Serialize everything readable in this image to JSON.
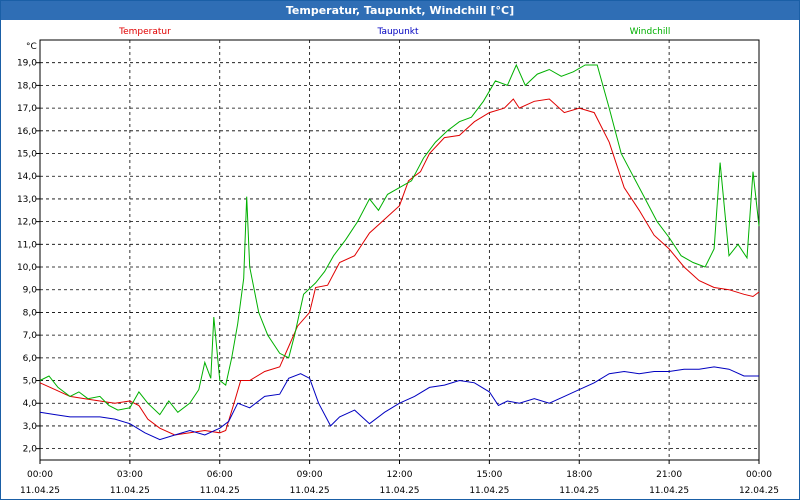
{
  "window": {
    "title": "Temperatur, Taupunkt, Windchill [°C]"
  },
  "chart_data": {
    "type": "line",
    "title": "Temperatur, Taupunkt, Windchill [°C]",
    "ylabel": "°C",
    "xlabel": "",
    "ylim": [
      1.5,
      20
    ],
    "xlim": [
      0,
      24
    ],
    "grid": true,
    "legend_placement": "top",
    "y_ticks": [
      "2,0",
      "3,0",
      "4,0",
      "5,0",
      "6,0",
      "7,0",
      "8,0",
      "9,0",
      "10,0",
      "11,0",
      "12,0",
      "13,0",
      "14,0",
      "15,0",
      "16,0",
      "17,0",
      "18,0",
      "19,0"
    ],
    "x_ticks": [
      {
        "time": "00:00",
        "date": "11.04.25"
      },
      {
        "time": "03:00",
        "date": "11.04.25"
      },
      {
        "time": "06:00",
        "date": "11.04.25"
      },
      {
        "time": "09:00",
        "date": "11.04.25"
      },
      {
        "time": "12:00",
        "date": "11.04.25"
      },
      {
        "time": "15:00",
        "date": "11.04.25"
      },
      {
        "time": "18:00",
        "date": "11.04.25"
      },
      {
        "time": "21:00",
        "date": "11.04.25"
      },
      {
        "time": "00:00",
        "date": "12.04.25"
      }
    ],
    "series": [
      {
        "name": "Temperatur",
        "color": "#e00000",
        "points": [
          [
            0,
            4.9
          ],
          [
            0.5,
            4.6
          ],
          [
            1,
            4.3
          ],
          [
            1.5,
            4.2
          ],
          [
            2,
            4.1
          ],
          [
            2.5,
            4.0
          ],
          [
            3,
            4.1
          ],
          [
            3.3,
            3.9
          ],
          [
            3.6,
            3.3
          ],
          [
            4,
            2.9
          ],
          [
            4.5,
            2.6
          ],
          [
            5,
            2.7
          ],
          [
            5.5,
            2.8
          ],
          [
            6,
            2.7
          ],
          [
            6.2,
            2.8
          ],
          [
            6.5,
            4.1
          ],
          [
            6.7,
            5.0
          ],
          [
            7,
            5.0
          ],
          [
            7.5,
            5.4
          ],
          [
            8,
            5.6
          ],
          [
            8.3,
            6.5
          ],
          [
            8.6,
            7.4
          ],
          [
            9,
            8.0
          ],
          [
            9.2,
            9.1
          ],
          [
            9.6,
            9.2
          ],
          [
            10,
            10.2
          ],
          [
            10.5,
            10.5
          ],
          [
            11,
            11.5
          ],
          [
            11.5,
            12.1
          ],
          [
            12,
            12.7
          ],
          [
            12.3,
            13.8
          ],
          [
            12.7,
            14.2
          ],
          [
            13,
            15.0
          ],
          [
            13.5,
            15.7
          ],
          [
            14,
            15.8
          ],
          [
            14.5,
            16.4
          ],
          [
            15,
            16.8
          ],
          [
            15.5,
            17.0
          ],
          [
            15.8,
            17.4
          ],
          [
            16,
            17.0
          ],
          [
            16.5,
            17.3
          ],
          [
            17,
            17.4
          ],
          [
            17.5,
            16.8
          ],
          [
            18,
            17.0
          ],
          [
            18.5,
            16.8
          ],
          [
            19,
            15.5
          ],
          [
            19.5,
            13.5
          ],
          [
            20,
            12.5
          ],
          [
            20.5,
            11.4
          ],
          [
            21,
            10.8
          ],
          [
            21.5,
            10.0
          ],
          [
            22,
            9.4
          ],
          [
            22.5,
            9.1
          ],
          [
            23,
            9.0
          ],
          [
            23.5,
            8.8
          ],
          [
            23.8,
            8.7
          ],
          [
            24,
            8.9
          ]
        ]
      },
      {
        "name": "Taupunkt",
        "color": "#0000c0",
        "points": [
          [
            0,
            3.6
          ],
          [
            0.5,
            3.5
          ],
          [
            1,
            3.4
          ],
          [
            1.5,
            3.4
          ],
          [
            2,
            3.4
          ],
          [
            2.5,
            3.3
          ],
          [
            3,
            3.1
          ],
          [
            3.5,
            2.7
          ],
          [
            4,
            2.4
          ],
          [
            4.5,
            2.6
          ],
          [
            5,
            2.8
          ],
          [
            5.5,
            2.6
          ],
          [
            6,
            2.9
          ],
          [
            6.3,
            3.2
          ],
          [
            6.6,
            4.0
          ],
          [
            7,
            3.8
          ],
          [
            7.5,
            4.3
          ],
          [
            8,
            4.4
          ],
          [
            8.3,
            5.1
          ],
          [
            8.7,
            5.3
          ],
          [
            9,
            5.1
          ],
          [
            9.3,
            4.0
          ],
          [
            9.7,
            3.0
          ],
          [
            10,
            3.4
          ],
          [
            10.5,
            3.7
          ],
          [
            11,
            3.1
          ],
          [
            11.5,
            3.6
          ],
          [
            12,
            4.0
          ],
          [
            12.5,
            4.3
          ],
          [
            13,
            4.7
          ],
          [
            13.5,
            4.8
          ],
          [
            14,
            5.0
          ],
          [
            14.5,
            4.9
          ],
          [
            15,
            4.5
          ],
          [
            15.3,
            3.9
          ],
          [
            15.6,
            4.1
          ],
          [
            16,
            4.0
          ],
          [
            16.5,
            4.2
          ],
          [
            17,
            4.0
          ],
          [
            17.5,
            4.3
          ],
          [
            18,
            4.6
          ],
          [
            18.5,
            4.9
          ],
          [
            19,
            5.3
          ],
          [
            19.5,
            5.4
          ],
          [
            20,
            5.3
          ],
          [
            20.5,
            5.4
          ],
          [
            21,
            5.4
          ],
          [
            21.5,
            5.5
          ],
          [
            22,
            5.5
          ],
          [
            22.5,
            5.6
          ],
          [
            23,
            5.5
          ],
          [
            23.5,
            5.2
          ],
          [
            24,
            5.2
          ]
        ]
      },
      {
        "name": "Windchill",
        "color": "#00b000",
        "points": [
          [
            0,
            5.0
          ],
          [
            0.3,
            5.2
          ],
          [
            0.6,
            4.7
          ],
          [
            1,
            4.3
          ],
          [
            1.3,
            4.5
          ],
          [
            1.6,
            4.2
          ],
          [
            2,
            4.3
          ],
          [
            2.3,
            3.9
          ],
          [
            2.6,
            3.7
          ],
          [
            3,
            3.8
          ],
          [
            3.3,
            4.5
          ],
          [
            3.6,
            4.0
          ],
          [
            4,
            3.5
          ],
          [
            4.3,
            4.1
          ],
          [
            4.6,
            3.6
          ],
          [
            5,
            4.0
          ],
          [
            5.3,
            4.6
          ],
          [
            5.5,
            5.8
          ],
          [
            5.7,
            5.1
          ],
          [
            5.8,
            7.8
          ],
          [
            6,
            5.0
          ],
          [
            6.2,
            4.8
          ],
          [
            6.4,
            6.0
          ],
          [
            6.6,
            7.5
          ],
          [
            6.8,
            9.5
          ],
          [
            6.9,
            13.1
          ],
          [
            7,
            10.0
          ],
          [
            7.3,
            8.0
          ],
          [
            7.6,
            7.0
          ],
          [
            8,
            6.2
          ],
          [
            8.3,
            6.0
          ],
          [
            8.5,
            7.0
          ],
          [
            8.8,
            8.8
          ],
          [
            9.2,
            9.3
          ],
          [
            9.5,
            9.8
          ],
          [
            9.8,
            10.5
          ],
          [
            10.2,
            11.2
          ],
          [
            10.6,
            12.0
          ],
          [
            11,
            13.0
          ],
          [
            11.3,
            12.5
          ],
          [
            11.6,
            13.2
          ],
          [
            12,
            13.5
          ],
          [
            12.4,
            13.8
          ],
          [
            12.8,
            14.8
          ],
          [
            13.2,
            15.5
          ],
          [
            13.6,
            16.0
          ],
          [
            14,
            16.4
          ],
          [
            14.4,
            16.6
          ],
          [
            14.8,
            17.3
          ],
          [
            15.2,
            18.2
          ],
          [
            15.6,
            18.0
          ],
          [
            15.9,
            18.9
          ],
          [
            16.2,
            18.0
          ],
          [
            16.6,
            18.5
          ],
          [
            17,
            18.7
          ],
          [
            17.4,
            18.4
          ],
          [
            17.8,
            18.6
          ],
          [
            18.2,
            18.9
          ],
          [
            18.6,
            18.9
          ],
          [
            19,
            17.0
          ],
          [
            19.4,
            15.0
          ],
          [
            19.8,
            14.0
          ],
          [
            20.2,
            13.0
          ],
          [
            20.6,
            12.0
          ],
          [
            21,
            11.3
          ],
          [
            21.4,
            10.5
          ],
          [
            21.8,
            10.2
          ],
          [
            22.2,
            10.0
          ],
          [
            22.5,
            10.8
          ],
          [
            22.7,
            14.6
          ],
          [
            23,
            10.5
          ],
          [
            23.3,
            11.0
          ],
          [
            23.6,
            10.4
          ],
          [
            23.8,
            14.2
          ],
          [
            24,
            11.8
          ]
        ]
      }
    ]
  }
}
